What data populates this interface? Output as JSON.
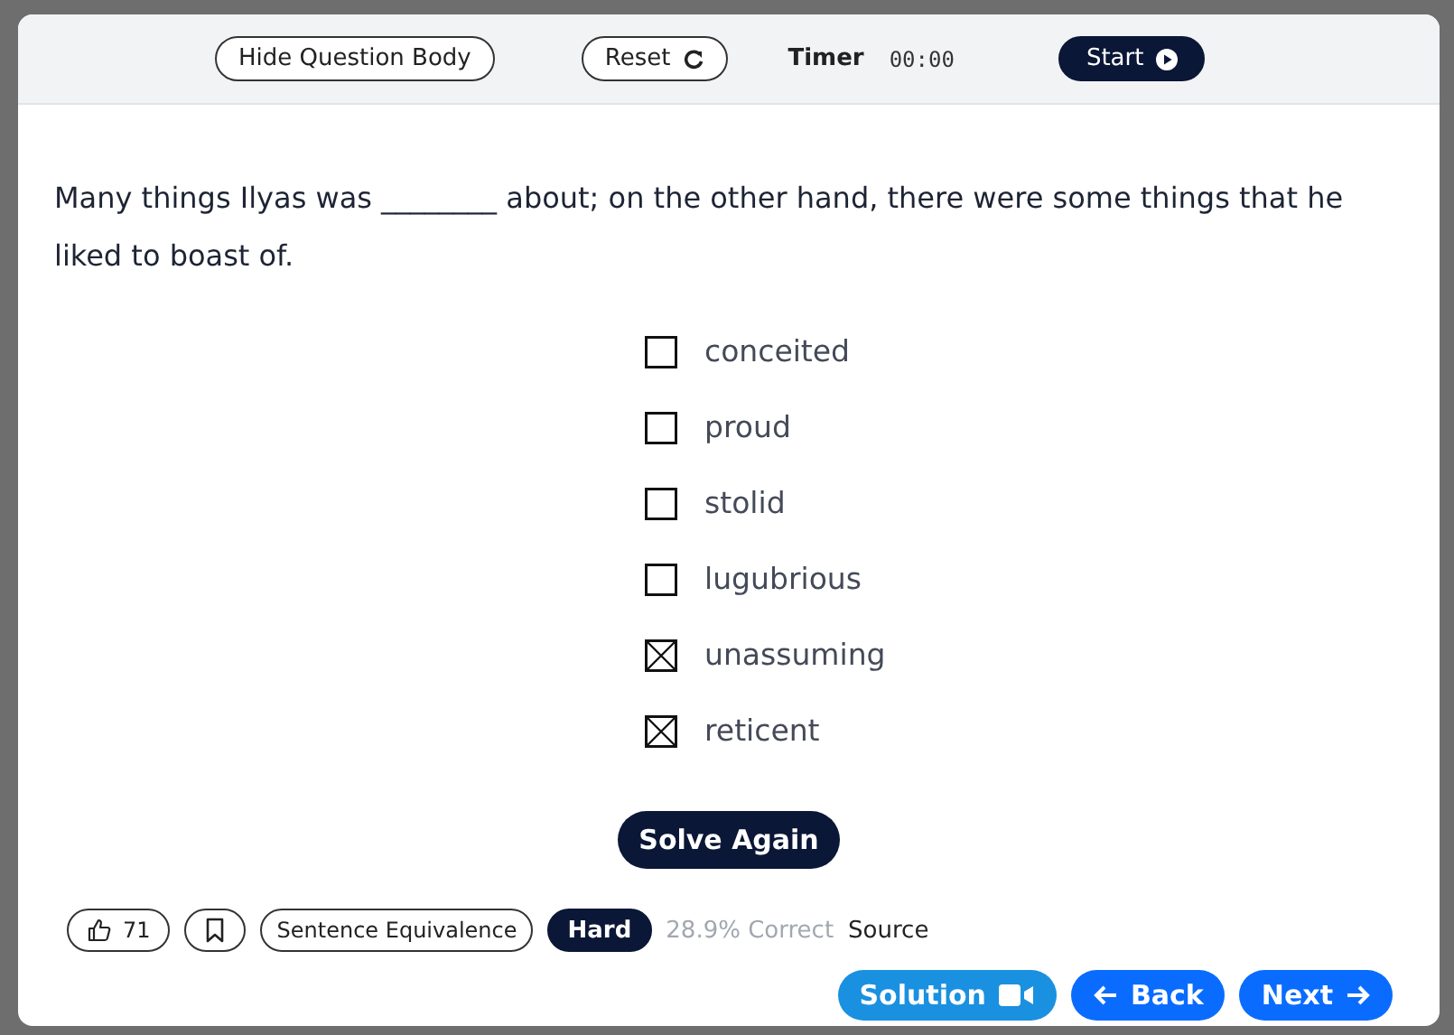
{
  "toolbar": {
    "hide_button": "Hide Question Body",
    "reset_button": "Reset",
    "timer_label": "Timer",
    "timer_value": "00:00",
    "start_button": "Start"
  },
  "question": "Many things Ilyas was ________ about; on the other hand, there were some things that he liked to boast of.",
  "options": [
    {
      "label": "conceited",
      "checked": false
    },
    {
      "label": "proud",
      "checked": false
    },
    {
      "label": "stolid",
      "checked": false
    },
    {
      "label": "lugubrious",
      "checked": false
    },
    {
      "label": "unassuming",
      "checked": true
    },
    {
      "label": "reticent",
      "checked": true
    }
  ],
  "solve_again_button": "Solve Again",
  "meta": {
    "likes": "71",
    "bookmarked": false,
    "category": "Sentence Equivalence",
    "difficulty": "Hard",
    "correct_rate": "28.9% Correct",
    "source": "Source"
  },
  "nav": {
    "solution": "Solution",
    "back": "Back",
    "next": "Next"
  }
}
